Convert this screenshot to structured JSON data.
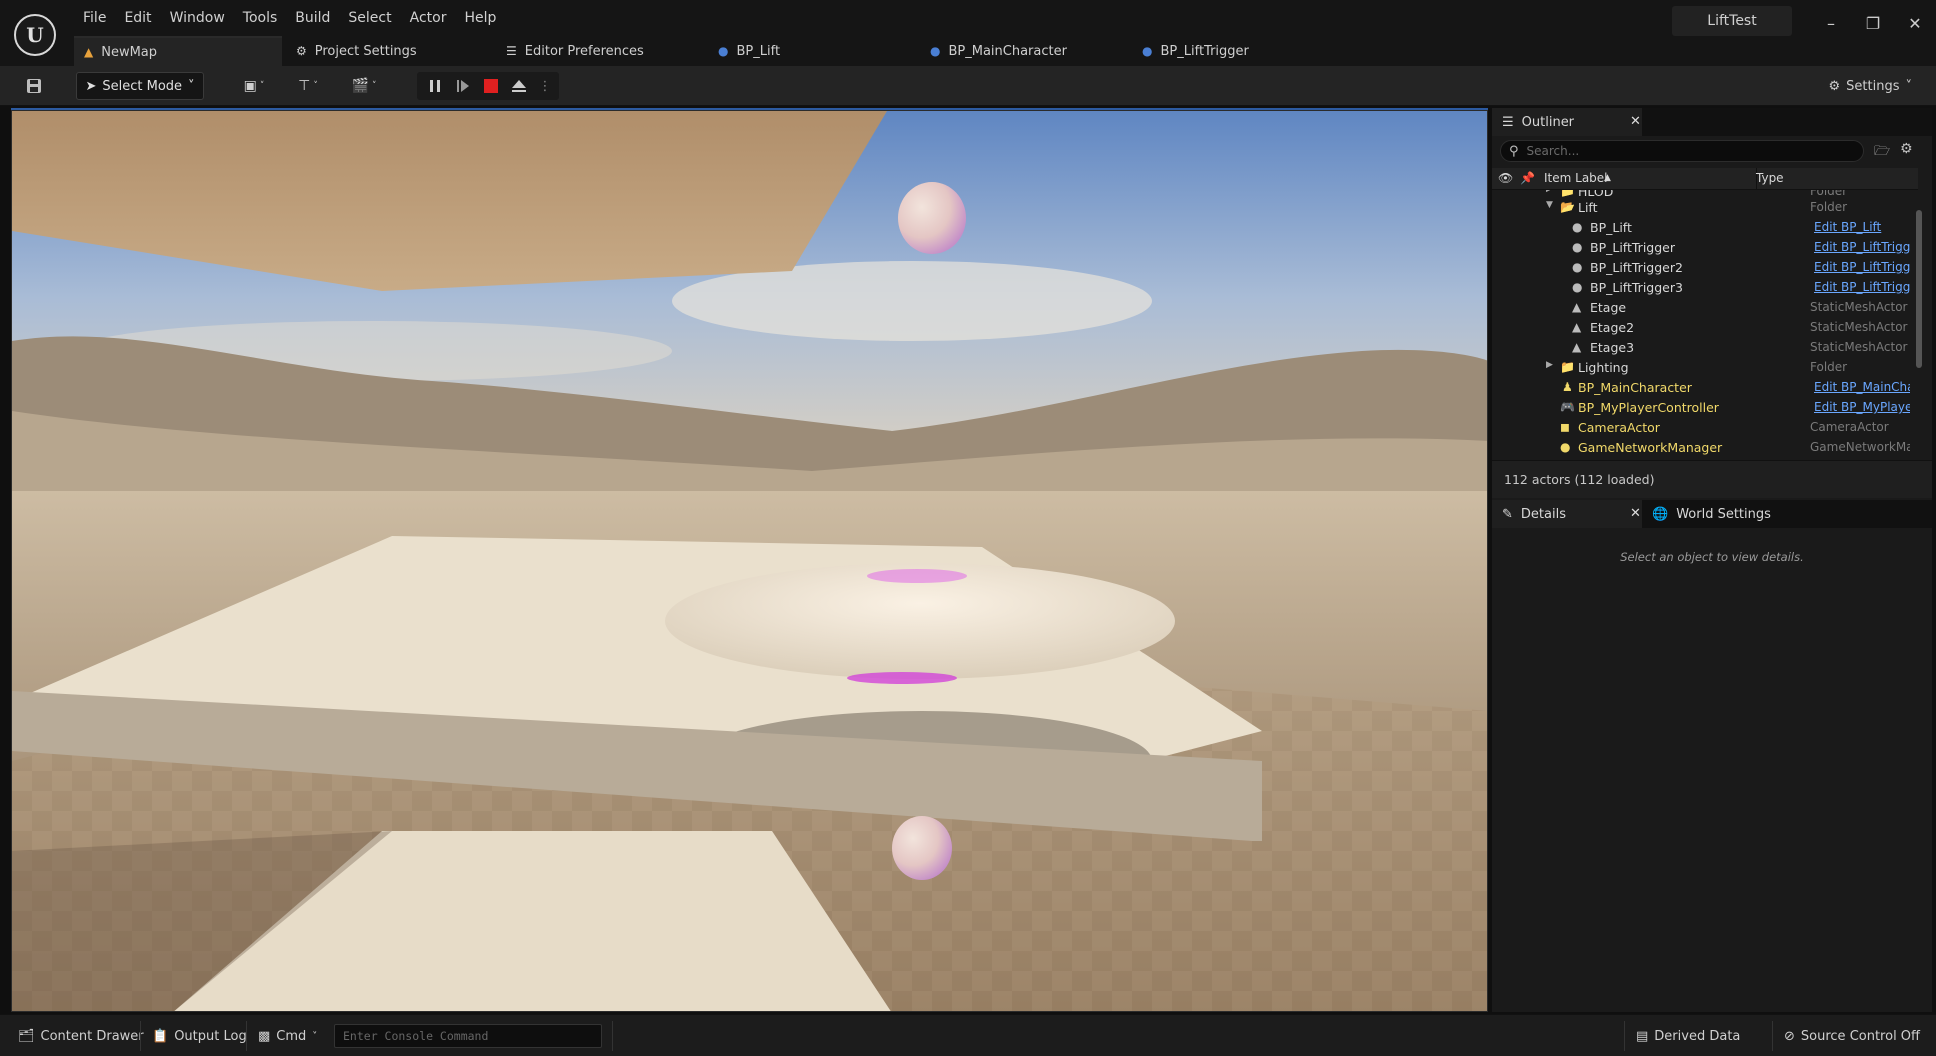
{
  "menu": [
    "File",
    "Edit",
    "Window",
    "Tools",
    "Build",
    "Select",
    "Actor",
    "Help"
  ],
  "project_name": "LiftTest",
  "tabs": {
    "newmap": "NewMap",
    "project_settings": "Project Settings",
    "editor_preferences": "Editor Preferences",
    "bp_lift": "BP_Lift",
    "bp_maincharacter": "BP_MainCharacter",
    "bp_lifttrigger": "BP_LiftTrigger"
  },
  "toolbar": {
    "select_mode": "Select Mode",
    "settings": "Settings"
  },
  "outliner": {
    "tab_label": "Outliner",
    "search_placeholder": "Search...",
    "col_item_label": "Item Label",
    "col_type": "Type",
    "rows": [
      {
        "label": "HLOD",
        "type": "Folder"
      },
      {
        "label": "Lift",
        "type": "Folder"
      },
      {
        "label": "BP_Lift",
        "type": "Edit BP_Lift"
      },
      {
        "label": "BP_LiftTrigger",
        "type": "Edit BP_LiftTrigg"
      },
      {
        "label": "BP_LiftTrigger2",
        "type": "Edit BP_LiftTrigg"
      },
      {
        "label": "BP_LiftTrigger3",
        "type": "Edit BP_LiftTrigg"
      },
      {
        "label": "Etage",
        "type": "StaticMeshActor"
      },
      {
        "label": "Etage2",
        "type": "StaticMeshActor"
      },
      {
        "label": "Etage3",
        "type": "StaticMeshActor"
      },
      {
        "label": "Lighting",
        "type": "Folder"
      },
      {
        "label": "BP_MainCharacter",
        "type": "Edit BP_MainCha"
      },
      {
        "label": "BP_MyPlayerController",
        "type": "Edit BP_MyPlaye"
      },
      {
        "label": "CameraActor",
        "type": "CameraActor"
      },
      {
        "label": "GameNetworkManager",
        "type": "GameNetworkMa"
      }
    ],
    "actors_count": "112 actors (112 loaded)"
  },
  "details": {
    "tab_label": "Details",
    "world_settings": "World Settings",
    "hint": "Select an object to view details."
  },
  "statusbar": {
    "content_drawer": "Content Drawer",
    "output_log": "Output Log",
    "cmd": "Cmd",
    "console_placeholder": "Enter Console Command",
    "derived_data": "Derived Data",
    "source_control": "Source Control Off"
  },
  "colors": {
    "link": "#6aa7ff",
    "folder": "#c8a25a",
    "stop": "#e02020",
    "accent": "#2c5aa0"
  }
}
